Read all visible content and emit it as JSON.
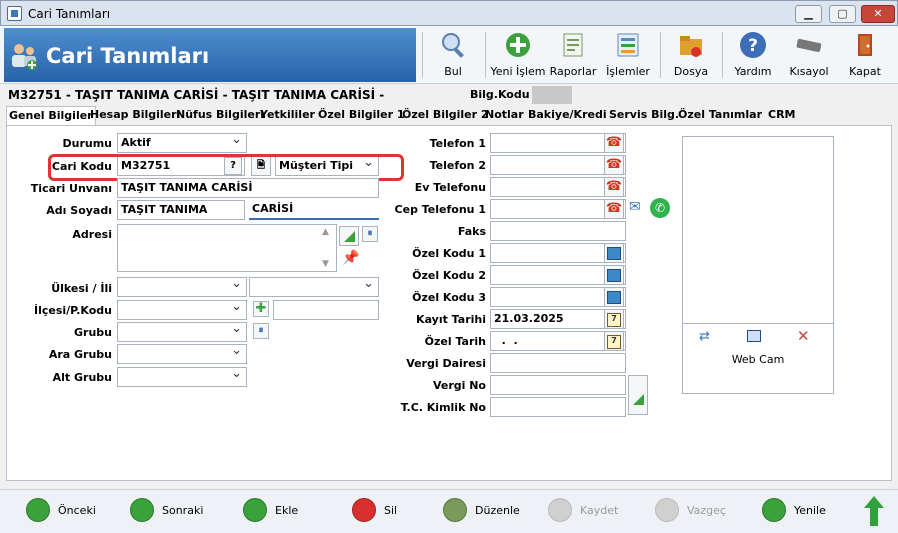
{
  "window": {
    "title": "Cari Tanımları"
  },
  "header": {
    "title": "Cari Tanımları",
    "toolbar": [
      {
        "id": "bul",
        "label": "Bul",
        "icon": "search-user-icon",
        "color": "#5b7fb0"
      },
      {
        "id": "yeni",
        "label": "Yeni İşlem",
        "icon": "plus-circle-icon",
        "color": "#3aa23a"
      },
      {
        "id": "raporlar",
        "label": "Raporlar",
        "icon": "report-icon",
        "color": "#7a9a5a"
      },
      {
        "id": "islemler",
        "label": "İşlemler",
        "icon": "list-icon",
        "color": "#5a8ac0"
      },
      {
        "id": "dosya",
        "label": "Dosya",
        "icon": "folder-icon",
        "color": "#e0a030"
      },
      {
        "id": "yardim",
        "label": "Yardım",
        "icon": "help-icon",
        "color": "#3d6fb8"
      },
      {
        "id": "kisayol",
        "label": "Kısayol",
        "icon": "keyboard-icon",
        "color": "#777777"
      },
      {
        "id": "kapat",
        "label": "Kapat",
        "icon": "exit-door-icon",
        "color": "#b34a1e"
      }
    ]
  },
  "info": {
    "cari_line": "M32751  -  TAŞIT TANIMA CARİSİ  -  TAŞIT TANIMA   CARİSİ  -",
    "bilg_label": "Bilg.Kodu :"
  },
  "tabs": [
    "Genel Bilgiler",
    "Hesap Bilgileri",
    "Nüfus Bilgileri",
    "Yetkililer",
    "Özel Bilgiler 1",
    "Özel Bilgiler 2",
    "Notlar",
    "Bakiye/Kredi",
    "Servis Bilg.",
    "Özel Tanımlar",
    "CRM"
  ],
  "form_left": {
    "durumu_label": "Durumu",
    "durumu_value": "Aktif",
    "cari_kodu_label": "Cari Kodu",
    "cari_kodu_value": "M32751",
    "cari_help": "?",
    "musteri_tipi_value": "Müşteri Tipi",
    "ticari_label": "Ticari Unvanı",
    "ticari_value": "TAŞIT TANIMA CARİSİ",
    "adsoyad_label": "Adı Soyadı",
    "ad_value": "TAŞIT TANIMA",
    "soyad_value": "CARİSİ",
    "adres_label": "Adresi",
    "ulke_label": "Ülkesi / İli",
    "ilce_label": "İlçesi/P.Kodu",
    "grubu_label": "Grubu",
    "ara_grubu_label": "Ara Grubu",
    "alt_grubu_label": "Alt Grubu"
  },
  "form_right": {
    "telefon1": "Telefon 1",
    "telefon2": "Telefon 2",
    "ev_telefonu": "Ev Telefonu",
    "cep_telefonu": "Cep Telefonu 1",
    "faks": "Faks",
    "ozel_kodu1": "Özel Kodu 1",
    "ozel_kodu2": "Özel Kodu 2",
    "ozel_kodu3": "Özel Kodu 3",
    "kayit_tarihi_label": "Kayıt Tarihi",
    "kayit_tarihi_value": "21.03.2025",
    "ozel_tarih_label": "Özel Tarih",
    "ozel_tarih_value": "  .  .",
    "vergi_dairesi": "Vergi Dairesi",
    "vergi_no": "Vergi No",
    "tc_kimlik": "T.C. Kimlik No"
  },
  "photo": {
    "webcam_label": "Web Cam"
  },
  "bottom": [
    {
      "id": "onceki",
      "label": "Önceki",
      "color": "#3aa23a",
      "enabled": true
    },
    {
      "id": "sonraki",
      "label": "Sonraki",
      "color": "#3aa23a",
      "enabled": true
    },
    {
      "id": "ekle",
      "label": "Ekle",
      "color": "#3aa23a",
      "enabled": true
    },
    {
      "id": "sil",
      "label": "Sil",
      "color": "#d92f2f",
      "enabled": true
    },
    {
      "id": "duzenle",
      "label": "Düzenle",
      "color": "#7a9a5a",
      "enabled": true
    },
    {
      "id": "kaydet",
      "label": "Kaydet",
      "color": "#cccccc",
      "enabled": false
    },
    {
      "id": "vazgec",
      "label": "Vazgeç",
      "color": "#cccccc",
      "enabled": false
    },
    {
      "id": "yenile",
      "label": "Yenile",
      "color": "#3aa23a",
      "enabled": true
    }
  ],
  "colors": {
    "banner": "#2f6fb6",
    "highlight": "#e03333",
    "accent": "#3c6cb0"
  }
}
